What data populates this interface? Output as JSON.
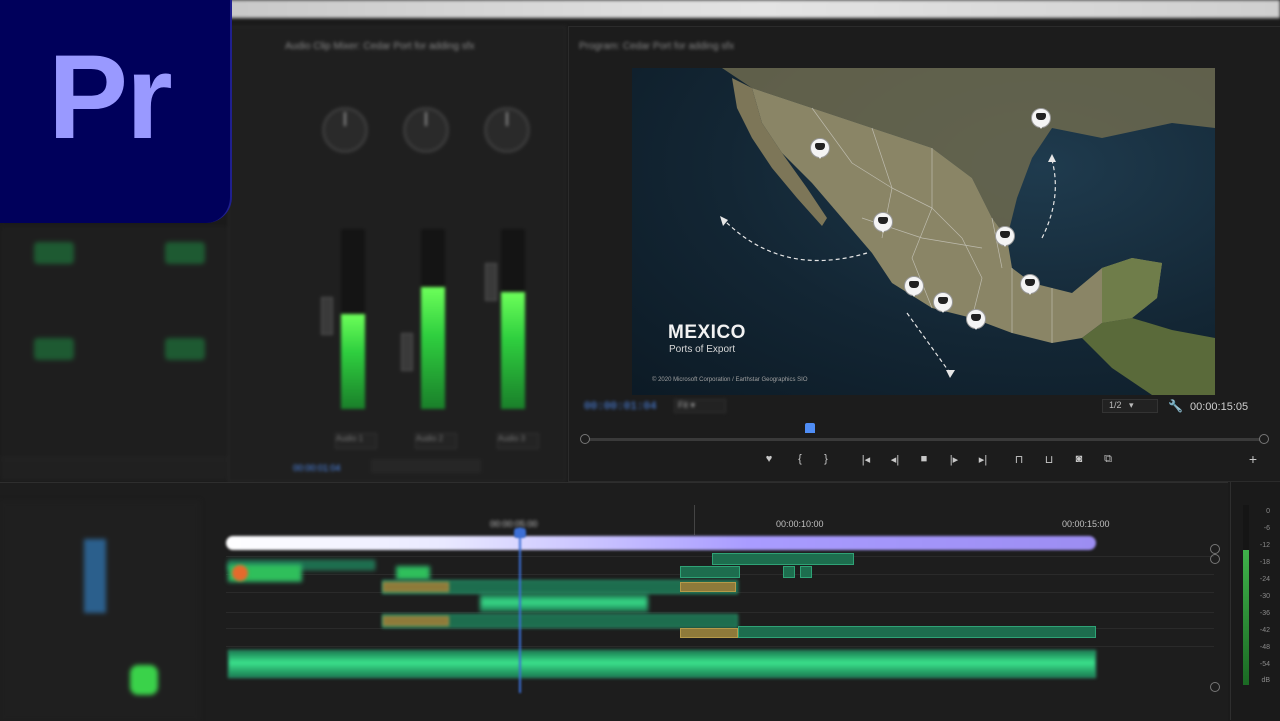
{
  "app": {
    "logo_text": "Pr",
    "logo_colors": {
      "bg": "#00005b",
      "text": "#9999ff"
    }
  },
  "program_monitor": {
    "title": "Program: Cedar Port for adding sfx",
    "map": {
      "title": "MEXICO",
      "subtitle": "Ports of Export",
      "copyright": "© 2020 Microsoft Corporation / Earthstar Geographics  SIO"
    },
    "timecode_current": "00:00:01:04",
    "fit": "Fit",
    "resolution": "1/2",
    "timecode_duration": "00:00:15:05",
    "icons": [
      "marker-icon",
      "mark-in-icon",
      "mark-out-icon",
      "go-to-in-icon",
      "step-back-icon",
      "stop-icon",
      "step-forward-icon",
      "go-to-out-icon",
      "lift-icon",
      "extract-icon",
      "camera-icon",
      "comparison-icon",
      "add-button-icon"
    ]
  },
  "audio_mixer": {
    "title": "Audio Clip Mixer: Cedar Port for adding sfx",
    "channels": [
      {
        "name": "Audio 1",
        "level": 0.53
      },
      {
        "name": "Audio 2",
        "level": 0.68
      },
      {
        "name": "Audio 3",
        "level": 0.65
      }
    ],
    "timecode": "00:00:01:04"
  },
  "timeline": {
    "ruler_labels": [
      "00:00:05:00",
      "00:00:10:00",
      "00:00:15:00"
    ],
    "db_scale": [
      "0",
      "-6",
      "-12",
      "-18",
      "-24",
      "-30",
      "-36",
      "-42",
      "-48",
      "-54",
      "dB"
    ]
  },
  "colors": {
    "accent_blue": "#4f8df5",
    "clip_green": "#2fa276",
    "work_area": "#9c8df2"
  }
}
